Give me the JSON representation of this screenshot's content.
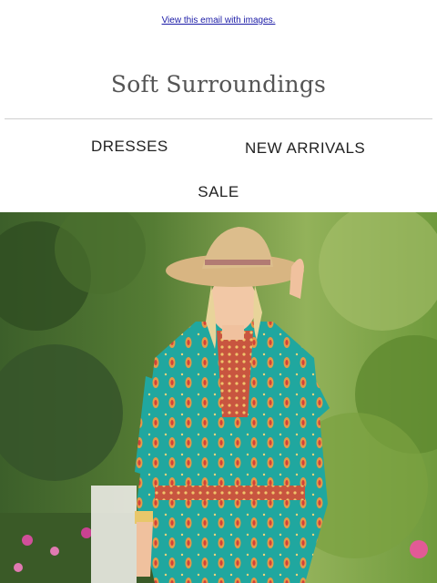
{
  "header": {
    "view_link": "View this email with images.",
    "logo_text": "Soft Surroundings"
  },
  "nav": {
    "dresses": "DRESSES",
    "new_arrivals": "NEW ARRIVALS",
    "sale": "SALE"
  },
  "colors": {
    "link": "#1a1aa6",
    "logo": "#555555",
    "nav_text": "#222222",
    "divider": "#cfcfcf",
    "dress_teal": "#1fa6a0",
    "hat": "#d9b888",
    "foliage": "#4f7a2e"
  }
}
